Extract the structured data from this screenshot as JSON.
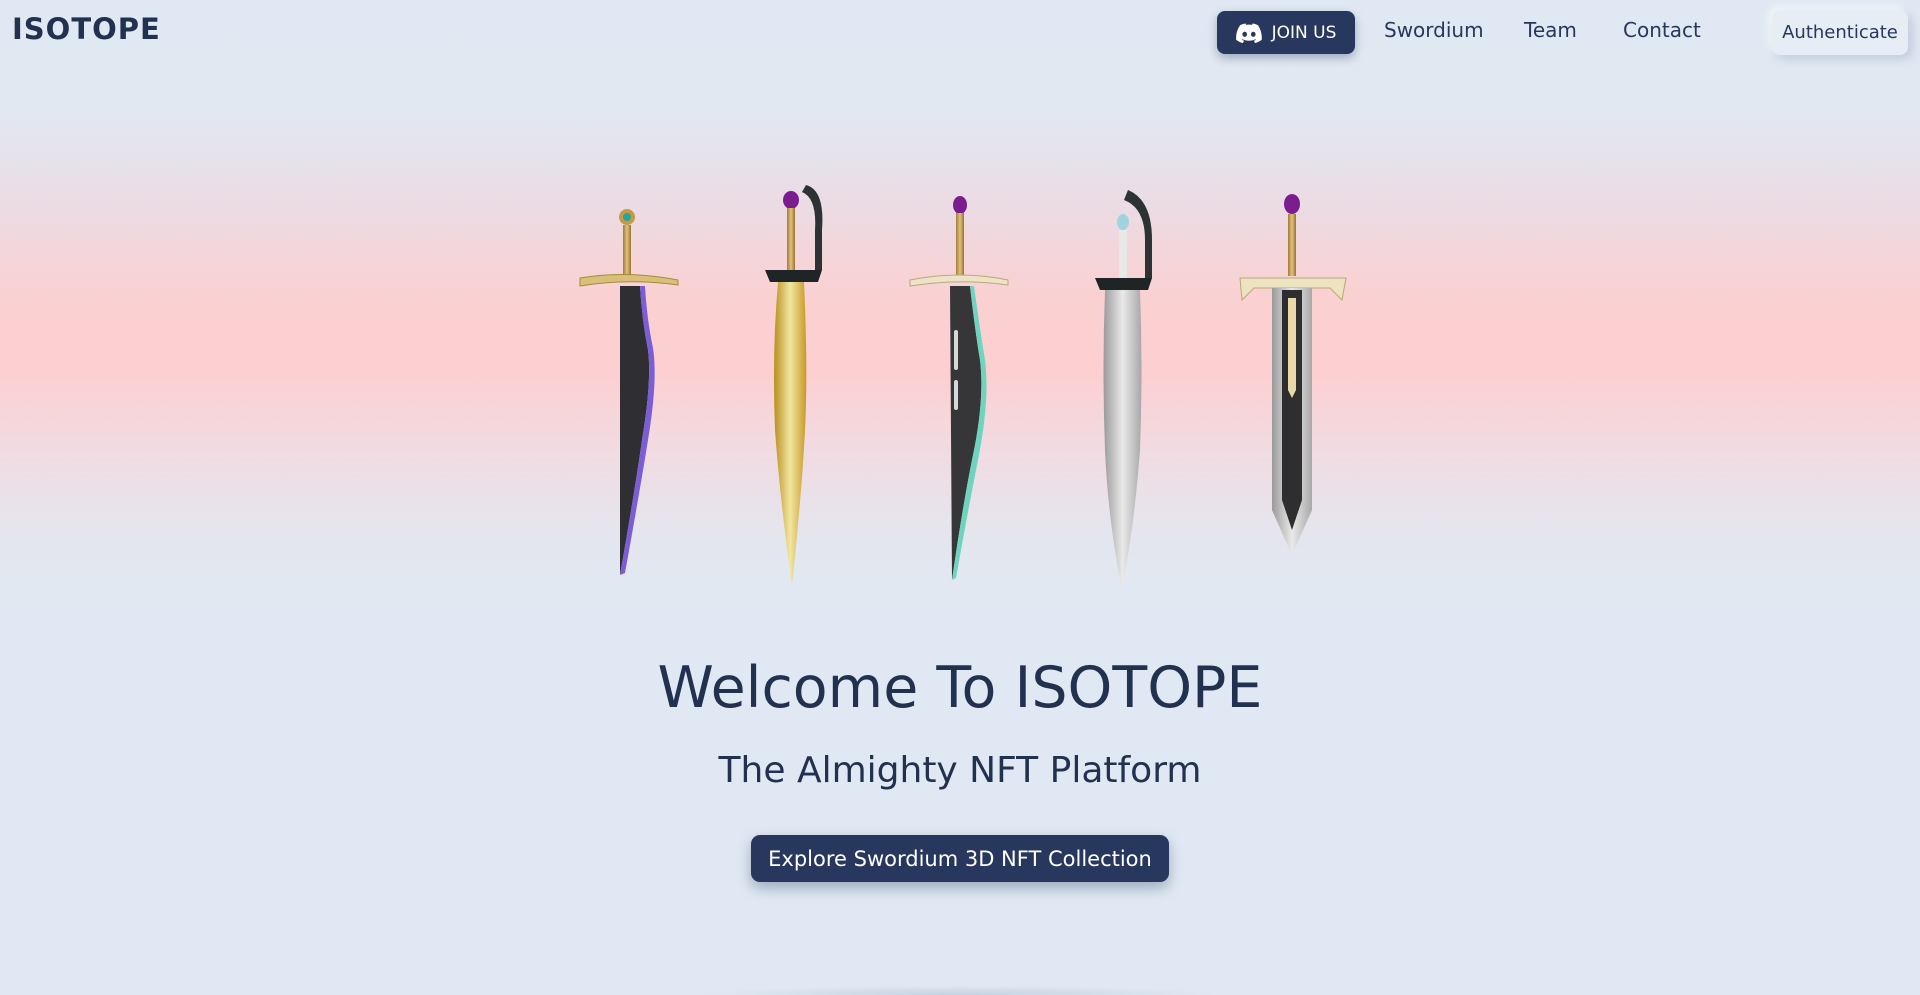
{
  "brand": {
    "name": "ISOTOPE"
  },
  "nav": {
    "join_label": "JOIN US",
    "links": [
      {
        "label": "Swordium"
      },
      {
        "label": "Team"
      },
      {
        "label": "Contact"
      }
    ],
    "auth_label": "Authenticate"
  },
  "hero": {
    "title": "Welcome To ISOTOPE",
    "subtitle": "The Almighty NFT Platform",
    "cta_label": "Explore Swordium 3D NFT Collection"
  },
  "icons": {
    "join": "discord-icon"
  },
  "colors": {
    "primary": "#27375d",
    "text": "#22314f",
    "background": "#e0e9f3",
    "glow": "#fdcfd0"
  }
}
